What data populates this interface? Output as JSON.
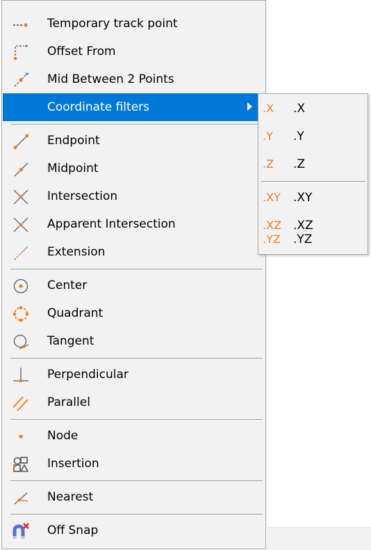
{
  "menu": {
    "items": [
      {
        "label": "Temporary track point",
        "icon": "temporary-track-point-icon"
      },
      {
        "label": "Offset From",
        "icon": "offset-from-icon"
      },
      {
        "label": "Mid Between 2 Points",
        "icon": "mid-between-2-points-icon"
      },
      {
        "label": "Coordinate filters",
        "icon": "",
        "highlighted": true,
        "has_submenu": true
      },
      {
        "label": "Endpoint",
        "icon": "endpoint-icon"
      },
      {
        "label": "Midpoint",
        "icon": "midpoint-icon"
      },
      {
        "label": "Intersection",
        "icon": "intersection-icon"
      },
      {
        "label": "Apparent Intersection",
        "icon": "apparent-intersection-icon"
      },
      {
        "label": "Extension",
        "icon": "extension-icon"
      },
      {
        "label": "Center",
        "icon": "center-icon"
      },
      {
        "label": "Quadrant",
        "icon": "quadrant-icon"
      },
      {
        "label": "Tangent",
        "icon": "tangent-icon"
      },
      {
        "label": "Perpendicular",
        "icon": "perpendicular-icon"
      },
      {
        "label": "Parallel",
        "icon": "parallel-icon"
      },
      {
        "label": "Node",
        "icon": "node-icon"
      },
      {
        "label": "Insertion",
        "icon": "insertion-icon"
      },
      {
        "label": "Nearest",
        "icon": "nearest-icon"
      },
      {
        "label": "Off Snap",
        "icon": "off-snap-icon"
      }
    ]
  },
  "submenu": {
    "items": [
      {
        "icon_text": ".X",
        "label": ".X"
      },
      {
        "icon_text": ".Y",
        "label": ".Y"
      },
      {
        "icon_text": ".Z",
        "label": ".Z"
      },
      {
        "icon_text": ".XY",
        "label": ".XY"
      },
      {
        "icon_text": ".XZ",
        "label": ".XZ"
      },
      {
        "icon_text": ".YZ",
        "label": ".YZ"
      }
    ]
  },
  "colors": {
    "accent_orange": "#f07d22",
    "highlight": "#0078d7",
    "icon_gray": "#6e6e6e"
  }
}
